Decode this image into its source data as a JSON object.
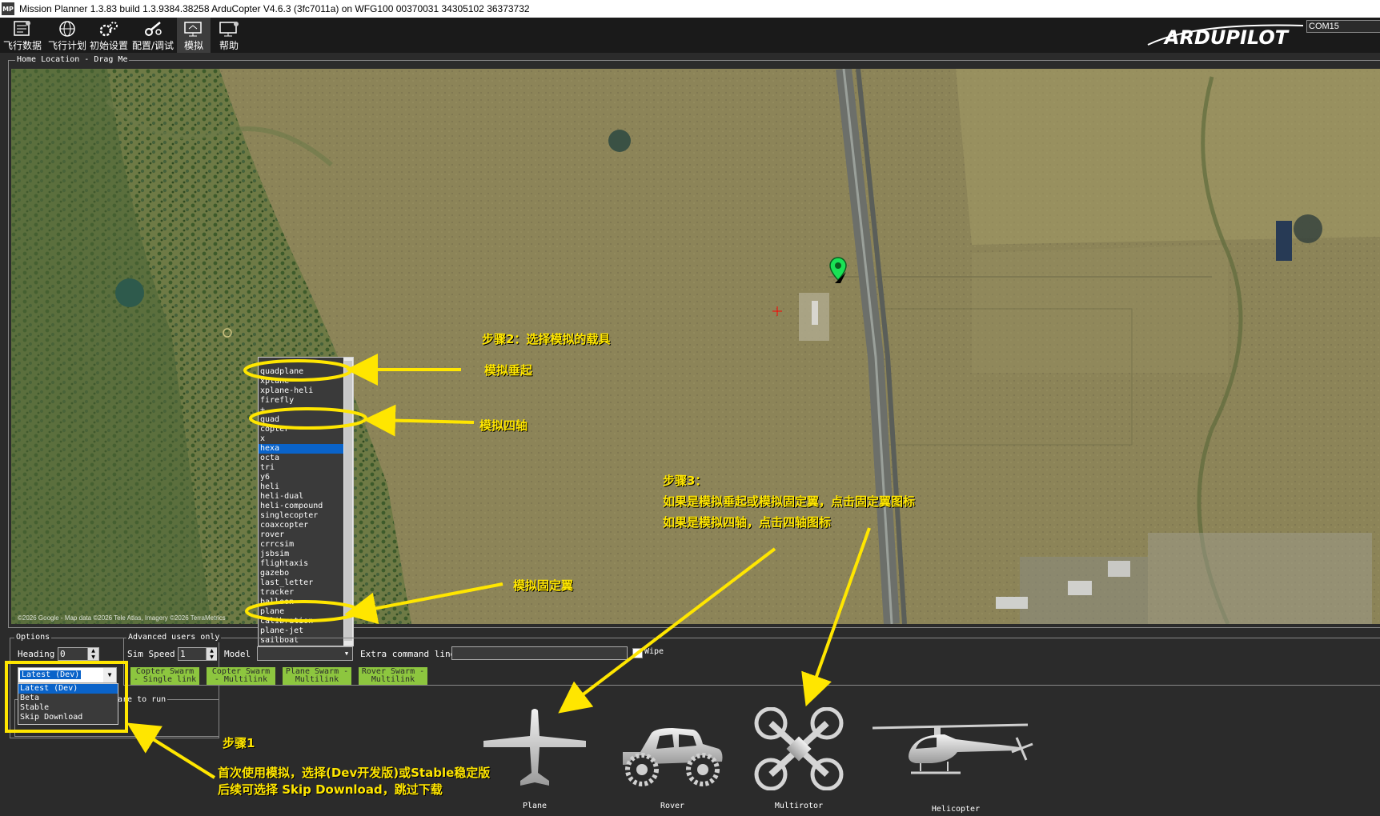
{
  "window": {
    "app_icon": "MP",
    "title": "Mission Planner 1.3.83 build 1.3.9384.38258 ArduCopter V4.6.3 (3fc7011a) on WFG100 00370031 34305102 36373732"
  },
  "menu": [
    {
      "label": "飞行数据",
      "icon": "flight-data-icon"
    },
    {
      "label": "飞行计划",
      "icon": "globe-icon"
    },
    {
      "label": "初始设置",
      "icon": "gears-icon"
    },
    {
      "label": "配置/调试",
      "icon": "wrench-icon"
    },
    {
      "label": "模拟",
      "icon": "simulation-icon"
    },
    {
      "label": "帮助",
      "icon": "help-icon"
    }
  ],
  "logo": {
    "text": "ARDUPILOT"
  },
  "com_port": "COM15",
  "map": {
    "group_label": "Home Location - Drag Me",
    "attribution": "©2026 Google - Map data ©2026 Tele Atlas, Imagery ©2026 TerraMetrics"
  },
  "model_list": {
    "items": [
      "quadplane",
      "xplane",
      "xplane-heli",
      "firefly",
      "+",
      "quad",
      "copter",
      "x",
      "hexa",
      "octa",
      "tri",
      "y6",
      "heli",
      "heli-dual",
      "heli-compound",
      "singlecopter",
      "coaxcopter",
      "rover",
      "crrcsim",
      "jsbsim",
      "flightaxis",
      "gazebo",
      "last_letter",
      "tracker",
      "balloon",
      "plane",
      "calibration",
      "plane-jet",
      "sailboat"
    ],
    "selected": "hexa"
  },
  "options": {
    "group_label": "Options",
    "heading_label": "Heading",
    "heading_value": "0",
    "version_selected": "Latest (Dev)",
    "version_options": [
      "Latest (Dev)",
      "Beta",
      "Stable",
      "Skip Download"
    ],
    "firmware_label_partial": "are to run"
  },
  "advanced": {
    "group_label": "Advanced users only",
    "sim_speed_label": "Sim Speed",
    "sim_speed_value": "1",
    "model_label": "Model",
    "model_value": "",
    "extra_cmd_label": "Extra command line",
    "extra_cmd_value": "",
    "wipe_label": "Wipe",
    "swarm_buttons": [
      {
        "line1": "Copter Swarm",
        "line2": "- Single link"
      },
      {
        "line1": "Copter Swarm",
        "line2": "- Multilink"
      },
      {
        "line1": "Plane Swarm -",
        "line2": "Multilink"
      },
      {
        "line1": "Rover Swarm -",
        "line2": "Multilink"
      }
    ]
  },
  "vehicles": [
    {
      "label": "Plane",
      "icon": "plane-icon"
    },
    {
      "label": "Rover",
      "icon": "rover-icon"
    },
    {
      "label": "Multirotor",
      "icon": "multirotor-icon"
    },
    {
      "label": "Helicopter",
      "icon": "helicopter-icon"
    }
  ],
  "annotations": {
    "step2_title": "步骤2：选择模拟的载具",
    "vtol": "模拟垂起",
    "quad": "模拟四轴",
    "fixed_wing": "模拟固定翼",
    "step3_line1": "步骤3：",
    "step3_line2": "如果是模拟垂起或模拟固定翼，点击固定翼图标",
    "step3_line3": "如果是模拟四轴，点击四轴图标",
    "step1_title": "步骤1",
    "step1_line1": "首次使用模拟，选择(Dev开发版)或Stable稳定版",
    "step1_line2": "后续可选择 Skip Download，跳过下载",
    "color": "#ffe600"
  }
}
